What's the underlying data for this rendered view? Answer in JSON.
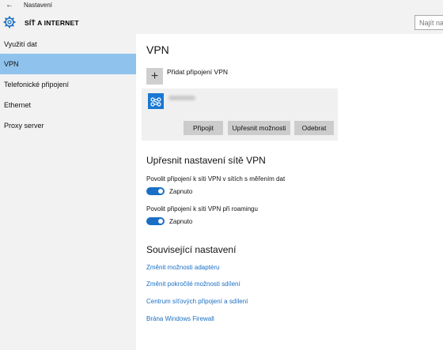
{
  "window": {
    "title": "Nastavení"
  },
  "header": {
    "title": "SÍŤ A INTERNET",
    "search_placeholder": "Najít nasta"
  },
  "sidebar": {
    "items": [
      {
        "label": "Využití dat"
      },
      {
        "label": "VPN"
      },
      {
        "label": "Telefonické připojení"
      },
      {
        "label": "Ethernet"
      },
      {
        "label": "Proxy server"
      }
    ]
  },
  "main": {
    "title": "VPN",
    "add_label": "Přidat připojení VPN",
    "connection": {
      "connect": "Připojit",
      "advanced": "Upřesnit možnosti",
      "remove": "Odebrat"
    },
    "advanced_title": "Upřesnit nastavení sítě VPN",
    "options": [
      {
        "label": "Povolit připojení k síti VPN v sítích s měřením dat",
        "state": "Zapnuto"
      },
      {
        "label": "Povolit připojení k síti VPN při roamingu",
        "state": "Zapnuto"
      }
    ],
    "related_title": "Související nastavení",
    "links": [
      "Změnit možnosti adaptéru",
      "Změnit pokročilé možnosti sdílení",
      "Centrum síťových připojení a sdílení",
      "Brána Windows Firewall"
    ]
  },
  "colors": {
    "accent": "#1a6fc4",
    "selected": "#8fc2ec",
    "sidebar_bg": "#f2f2f2"
  }
}
